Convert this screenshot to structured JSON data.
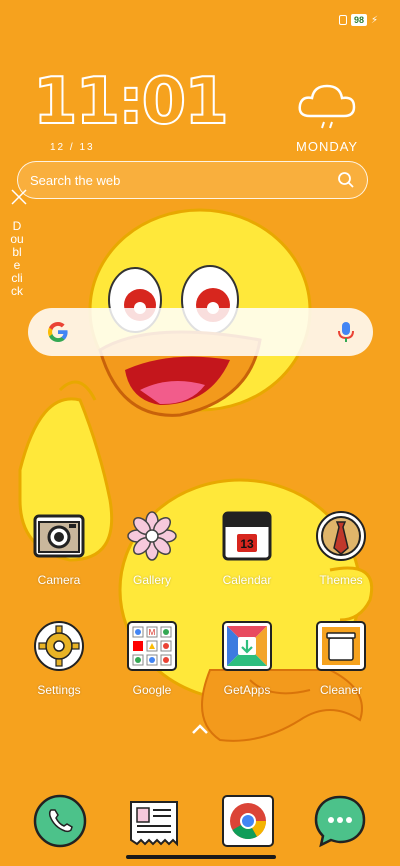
{
  "status": {
    "battery": "98",
    "charging_icon": "bolt-icon",
    "sim_icon": "sim-icon"
  },
  "clock": {
    "time": "11:01",
    "date": "12 / 13",
    "day": "MONDAY",
    "weather_icon": "cloud-rain-icon"
  },
  "web_search": {
    "placeholder": "Search the web",
    "icon": "search-icon"
  },
  "hint": {
    "text": "Double click",
    "close_icon": "close-icon"
  },
  "google_bar": {
    "logo": "google-g-icon",
    "mic": "mic-icon"
  },
  "apps": [
    {
      "label": "Camera",
      "icon": "camera-icon"
    },
    {
      "label": "Gallery",
      "icon": "flower-icon"
    },
    {
      "label": "Calendar",
      "icon": "calendar-icon",
      "day": "13"
    },
    {
      "label": "Themes",
      "icon": "tie-icon"
    },
    {
      "label": "Settings",
      "icon": "gear-icon"
    },
    {
      "label": "Google",
      "icon": "google-folder-icon"
    },
    {
      "label": "GetApps",
      "icon": "getapps-icon"
    },
    {
      "label": "Cleaner",
      "icon": "trash-icon"
    }
  ],
  "dock": [
    {
      "icon": "phone-icon"
    },
    {
      "icon": "contacts-icon"
    },
    {
      "icon": "chrome-icon"
    },
    {
      "icon": "messages-icon"
    }
  ],
  "colors": {
    "background": "#F6A21E",
    "accent_green": "#3DDC84"
  }
}
